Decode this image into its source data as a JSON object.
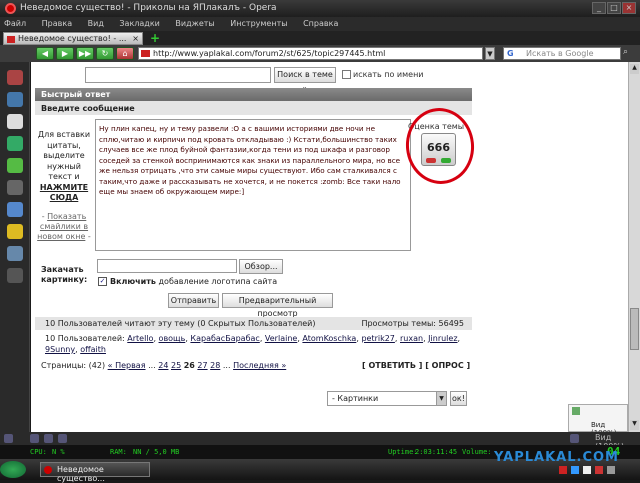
{
  "window": {
    "title": "Неведомое существо! - Приколы на ЯПлакалъ - Opera"
  },
  "menu": {
    "items": [
      "Файл",
      "Правка",
      "Вид",
      "Закладки",
      "Виджеты",
      "Инструменты",
      "Справка"
    ]
  },
  "tab": {
    "title": "Неведомое существо! - ..."
  },
  "address_bar": {
    "url": "http://www.yaplakal.com/forum2/st/625/topic297445.html"
  },
  "web_search": {
    "placeholder": "Искать в Google"
  },
  "forum_search": {
    "button_label": "Поиск в теме »",
    "checkbox_label": "искать по имени"
  },
  "quick_reply": {
    "header": "Быстрый ответ",
    "subheader": "Введите сообщение",
    "help_text": "Для вставки цитаты, выделите нужный текст и",
    "help_cta": "НАЖМИТЕ СЮДА",
    "smilies_prefix": "- ",
    "smilies_link": "Показать смайлики в новом окне",
    "smilies_suffix": " -",
    "message_text": "Ну плин капец, ну и тему развели  :О а с вашими историями две ночи не сплю,читаю и кирпичи под кровать откладываю :) Кстати,большинство таких случаев все же плод буйной фантазии,когда тени из под шкафа и разговор соседей за стенкой воспринимаются как знаки из параллельного мира, но все же нельзя отрицать ,что эти самые миры существуют. Ибо сам сталкивался с таким,что даже и рассказывать не хочется, и не покется :zomb: Все таки нало еще мы знаем об окружающем мире:]",
    "attach_label": "Закачать картинку:",
    "browse_button": "Обзор...",
    "logo_checkbox_bold": "Включить",
    "logo_checkbox_rest": " добавление логотипа сайта",
    "submit_button": "Отправить",
    "preview_button": "Предварительный просмотр"
  },
  "rating": {
    "label": "Оценка темы",
    "value": "666"
  },
  "readers": {
    "summary": "10 Пользователей читают эту тему (0 Скрытых Пользователей)",
    "views": "Просмотры темы: 56495",
    "list_prefix": "10 Пользователей: ",
    "users": [
      "Artello",
      "овощь",
      "КарабасБарабас",
      "Verlaine",
      "AtomKoschka",
      "petrik27",
      "ruxan",
      "Jinrulez",
      "9Sunny",
      "offaith"
    ]
  },
  "pagination": {
    "label": "Страницы: (42)",
    "first": "« Первая",
    "ellipsis": "...",
    "pages": [
      "24",
      "25",
      "26",
      "27",
      "28"
    ],
    "current": "26",
    "last": "Последняя »",
    "reply": "[ ОТВЕТИТЬ ]",
    "poll": "[ ОПРОС ]"
  },
  "jump": {
    "selected": "- Картинки",
    "ok": "ок!"
  },
  "popup": {
    "text": "Вид (100%)"
  },
  "system_monitor": {
    "cpu": "CPU:",
    "cpu_val": "N %",
    "ram": "RAM:",
    "ram_val": "NN / 5,0 MB",
    "uptime": "Uptime:",
    "uptime_val": "2:03:11:45",
    "volume": "Volume:",
    "clock": "04"
  },
  "taskbar": {
    "task_label": "Неведомое существо..."
  },
  "watermark": "YAPLAKAL.COM",
  "colors": {
    "annotation_circle": "#d60010",
    "section_header": "#7a7a7a",
    "monitor_text": "#22cc22"
  }
}
